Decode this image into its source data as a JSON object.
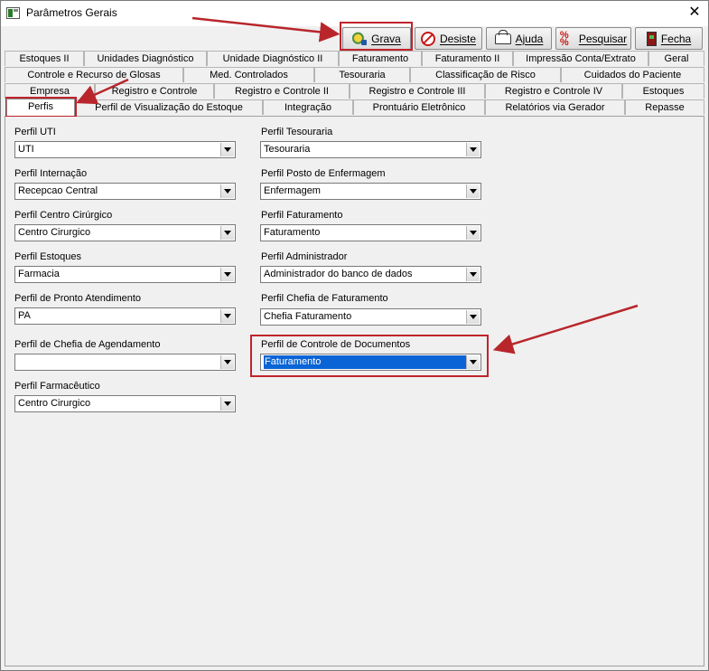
{
  "window": {
    "title": "Parâmetros Gerais",
    "close_glyph": "✕"
  },
  "toolbar": {
    "grava": "Grava",
    "desiste": "Desiste",
    "ajuda": "Ajuda",
    "pesquisar": "Pesquisar",
    "fecha": "Fecha",
    "pesquisar_icon_glyph": "% –\n%"
  },
  "tabs": {
    "row1": [
      "Estoques II",
      "Unidades Diagnóstico",
      "Unidade Diagnóstico II",
      "Faturamento",
      "Faturamento II",
      "Impressão Conta/Extrato",
      "Geral"
    ],
    "row2": [
      "Controle e Recurso de Glosas",
      "Med. Controlados",
      "Tesouraria",
      "Classificação de Risco",
      "Cuidados do Paciente"
    ],
    "row3": [
      "Empresa",
      "Registro e Controle",
      "Registro e Controle II",
      "Registro e Controle III",
      "Registro e Controle IV",
      "Estoques"
    ],
    "row4": [
      "Perfis",
      "Perfil de Visualização do Estoque",
      "Integração",
      "Prontuário Eletrônico",
      "Relatórios via Gerador",
      "Repasse"
    ]
  },
  "fields_left": [
    {
      "label": "Perfil UTI",
      "value": "UTI"
    },
    {
      "label": "Perfil Internação",
      "value": "Recepcao Central"
    },
    {
      "label": "Perfil Centro Cirúrgico",
      "value": "Centro Cirurgico"
    },
    {
      "label": "Perfil Estoques",
      "value": "Farmacia"
    },
    {
      "label": "Perfil de Pronto Atendimento",
      "value": "PA"
    },
    {
      "label": "Perfil de Chefia de Agendamento",
      "value": ""
    },
    {
      "label": "Perfil Farmacêutico",
      "value": "Centro Cirurgico"
    }
  ],
  "fields_right": [
    {
      "label": "Perfil Tesouraria",
      "value": "Tesouraria"
    },
    {
      "label": "Perfil Posto de Enfermagem",
      "value": "Enfermagem"
    },
    {
      "label": "Perfil Faturamento",
      "value": "Faturamento"
    },
    {
      "label": "Perfil Administrador",
      "value": "Administrador do banco de dados"
    },
    {
      "label": "Perfil Chefia de Faturamento",
      "value": "Chefia Faturamento"
    },
    {
      "label": "Perfil de Controle de Documentos",
      "value": "Faturamento"
    }
  ],
  "colors": {
    "annotation": "#c0242b",
    "selection": "#0a64d6"
  }
}
